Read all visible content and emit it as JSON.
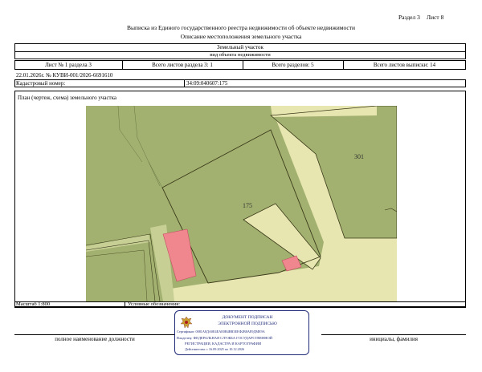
{
  "header": {
    "section": "Раздел 3",
    "sheet": "Лист 8",
    "title": "Выписка из Единого государственного реестра недвижимости об объекте недвижимости",
    "subtitle": "Описание местоположения земельного участка"
  },
  "object": {
    "type": "Земельный участок",
    "type_caption": "вид объекта недвижимости"
  },
  "info_row": {
    "sheet_of_section": "Лист № 1 раздела 3",
    "total_sheets_section": "Всего листов раздела 3: 1",
    "total_sections": "Всего разделов: 5",
    "total_sheets_extract": "Всего листов выписки: 14"
  },
  "doc": {
    "date_number": "22.01.2026г. № КУВИ-001/2026-6691610",
    "cadastral_label": "Кадастровый номер:",
    "cadastral_number": "34:09:040607:175"
  },
  "plan": {
    "title": "План (чертеж, схема) земельного участка",
    "label_main": "175",
    "label_neighbor": "301"
  },
  "footer": {
    "scale": "Масштаб 1:800",
    "legend": "Условные обозначения:",
    "position_caption": "полное наименование должности",
    "name_caption": "инициалы, фамилия"
  },
  "stamp": {
    "line1": "ДОКУМЕНТ ПОДПИСАН",
    "line2": "ЭЛЕКТРОННОЙ ПОДПИСЬЮ",
    "cert": "Сертификат: 0081А8ДА0Е4ЕАЕ0В4ВВ3ЕЕФ2В8АЕ9ДМЕ9А",
    "owner": "Владелец: ФЕДЕРАЛЬНАЯ СЛУЖБА ГОСУДАРСТВЕННОЙ",
    "owner2": "РЕГИСТРАЦИИ, КАДАСТРА И КАРТОГРАФИИ",
    "valid": "Действителен: с 16.09.2025 по 10.12.2026"
  },
  "colors": {
    "map_dark": "#a2b16f",
    "map_light": "#e8e6b0",
    "building": "#f0878f",
    "stamp": "#1f2a78"
  }
}
